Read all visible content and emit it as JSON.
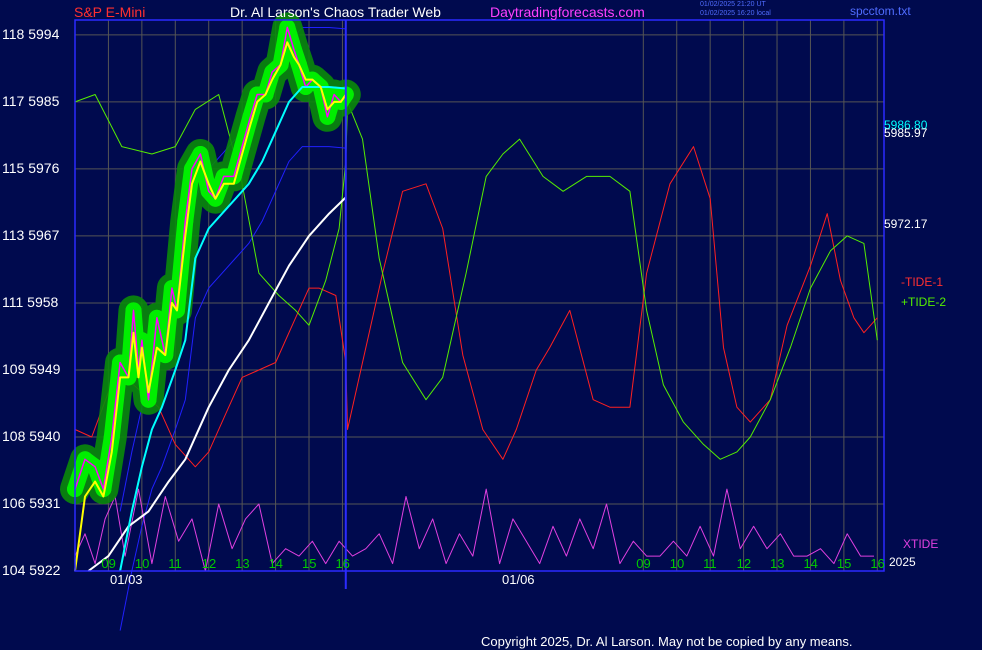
{
  "header": {
    "instrument": "S&P E-Mini",
    "site_title": "Dr. Al Larson's Chaos Trader Web",
    "site_link": "Daytradingforecasts.com",
    "timestamp_ut": "01/02/2025 21:20 UT",
    "timestamp_local": "01/02/2025 16:20 local",
    "data_file": "spcctom.txt"
  },
  "footer": {
    "copyright": "Copyright 2025, Dr. Al Larson. May not be copied by any means."
  },
  "colors": {
    "background": "#000a4e",
    "frame": "#2b2bff",
    "grid": "#555555",
    "price_halo": "#00ee00",
    "price_core": "#ff00ff",
    "fast_ma": "#ffff00",
    "medium_ma": "#00ffff",
    "slow_ma": "#ffffff",
    "tide_1": "#ff2020",
    "tide_2": "#55ee00",
    "xtide": "#e040e0",
    "channel": "#2020ff"
  },
  "chart_data": {
    "type": "line",
    "title": "S&P E-Mini",
    "y_axis_labels": [
      "118 5994",
      "117 5985",
      "115 5976",
      "113 5967",
      "111 5958",
      "109 5949",
      "108 5940",
      "106 5931",
      "104 5922"
    ],
    "y_ticks": [
      5994,
      5985,
      5976,
      5967,
      5958,
      5949,
      5940,
      5931,
      5922
    ],
    "ylim": [
      5922,
      5996
    ],
    "x_tick_labels": [
      "09",
      "10",
      "11",
      "12",
      "13",
      "14",
      "15",
      "16",
      "09",
      "10",
      "11",
      "12",
      "13",
      "14",
      "15",
      "16"
    ],
    "x_hours": [
      9,
      10,
      11,
      12,
      13,
      14,
      15,
      16,
      25,
      26,
      27,
      28,
      29,
      30,
      31,
      32
    ],
    "x_range_hours": [
      8,
      32.2
    ],
    "session_divider_hour": 16.1,
    "dates": [
      {
        "label": "01/03",
        "hour": 8.6
      },
      {
        "label": "01/06",
        "hour": 24.9
      }
    ],
    "year_label": "2025",
    "grid": true,
    "price_readouts": [
      "5986.80",
      "5985.97",
      "5972.17"
    ],
    "series": [
      {
        "name": "price",
        "x": [
          8.0,
          8.3,
          8.6,
          8.85,
          9.1,
          9.35,
          9.6,
          9.75,
          9.9,
          10.0,
          10.2,
          10.45,
          10.7,
          10.9,
          11.05,
          11.3,
          11.5,
          11.75,
          12.0,
          12.2,
          12.45,
          12.75,
          13.0,
          13.25,
          13.45,
          13.7,
          13.9,
          14.15,
          14.35,
          14.55,
          14.7,
          14.9,
          15.1,
          15.35,
          15.55,
          15.75,
          15.95,
          16.1
        ],
        "y": [
          5933,
          5937,
          5936,
          5933,
          5940,
          5950,
          5948,
          5957,
          5949,
          5953,
          5945,
          5956,
          5951,
          5960,
          5957,
          5969,
          5976,
          5978,
          5973,
          5972,
          5975,
          5975,
          5979,
          5983,
          5986,
          5986,
          5989,
          5990,
          5995,
          5992,
          5990,
          5987,
          5988,
          5987,
          5983,
          5986,
          5985,
          5986
        ]
      },
      {
        "name": "fast average",
        "x": [
          8.0,
          8.3,
          8.6,
          8.85,
          9.1,
          9.35,
          9.6,
          9.75,
          9.9,
          10.0,
          10.2,
          10.45,
          10.7,
          10.9,
          11.05,
          11.3,
          11.5,
          11.75,
          12.0,
          12.2,
          12.45,
          12.75,
          13.0,
          13.25,
          13.45,
          13.7,
          13.9,
          14.15,
          14.35,
          14.55,
          14.7,
          14.9,
          15.1,
          15.35,
          15.55,
          15.75,
          15.95,
          16.1
        ],
        "y": [
          5922,
          5932,
          5934,
          5932,
          5938,
          5948,
          5948,
          5954,
          5948,
          5952,
          5946,
          5952,
          5951,
          5958,
          5957,
          5967,
          5974,
          5977,
          5974,
          5972,
          5974,
          5974,
          5978,
          5982,
          5985,
          5986,
          5988,
          5990,
          5993,
          5991,
          5990,
          5988,
          5988,
          5987,
          5984,
          5985,
          5985,
          5985.97
        ]
      },
      {
        "name": "medium average",
        "x": [
          9.35,
          9.7,
          10.0,
          10.3,
          10.6,
          11.0,
          11.3,
          11.6,
          12.0,
          12.4,
          12.8,
          13.2,
          13.6,
          14.0,
          14.4,
          14.8,
          15.2,
          15.6,
          16.1
        ],
        "y": [
          5922,
          5930,
          5936,
          5941,
          5944,
          5949,
          5953,
          5964,
          5968,
          5970,
          5972,
          5974,
          5977,
          5981,
          5985,
          5987,
          5987,
          5987,
          5986.8
        ]
      },
      {
        "name": "slow average",
        "x": [
          8.4,
          9.0,
          9.6,
          10.2,
          10.8,
          11.3,
          12.0,
          12.6,
          13.2,
          13.8,
          14.4,
          15.0,
          15.6,
          16.1
        ],
        "y": [
          5922,
          5924,
          5928,
          5930,
          5934,
          5937,
          5944,
          5949,
          5953,
          5958,
          5963,
          5967,
          5970,
          5972.17
        ]
      },
      {
        "name": "TIDE-1",
        "x": [
          8.0,
          8.5,
          9.0,
          9.5,
          10.0,
          10.5,
          11.0,
          11.6,
          12.0,
          12.5,
          13.0,
          13.5,
          14.0,
          14.6,
          15.0,
          15.3,
          15.8,
          16.1,
          16.15,
          16.6,
          17.2,
          17.8,
          18.5,
          19.0,
          19.6,
          20.2,
          20.8,
          21.2,
          21.8,
          22.2,
          22.8,
          23.5,
          24.0,
          24.6,
          25.1,
          25.8,
          26.5,
          27.0,
          27.4,
          27.8,
          28.2,
          28.8,
          29.3,
          30.0,
          30.5,
          30.9,
          31.3,
          31.6,
          32.0
        ],
        "y": [
          5941,
          5940,
          5946,
          5948,
          5946,
          5944,
          5939,
          5936,
          5938,
          5943,
          5948,
          5949,
          5950,
          5956,
          5960,
          5960,
          5959,
          5950,
          5941,
          5950,
          5962,
          5973,
          5974,
          5968,
          5951,
          5941,
          5937,
          5941,
          5949,
          5952,
          5957,
          5945,
          5944,
          5944,
          5962,
          5974,
          5979,
          5972,
          5952,
          5944,
          5942,
          5945,
          5955,
          5963,
          5970,
          5961,
          5956,
          5954,
          5956
        ]
      },
      {
        "name": "TIDE-2",
        "x": [
          8.0,
          8.6,
          9.4,
          10.3,
          11.0,
          11.6,
          12.3,
          13.0,
          13.5,
          14.1,
          14.6,
          15.0,
          15.5,
          15.9,
          16.1,
          16.15,
          16.6,
          17.1,
          17.8,
          18.5,
          19.0,
          19.7,
          20.3,
          20.8,
          21.3,
          22.0,
          22.6,
          23.3,
          24.0,
          24.6,
          25.1,
          25.6,
          26.2,
          26.8,
          27.3,
          27.8,
          28.2,
          28.8,
          29.4,
          30.0,
          30.6,
          31.1,
          31.6,
          32.0
        ],
        "y": [
          5985,
          5986,
          5979,
          5978,
          5979,
          5984,
          5986,
          5974,
          5962,
          5959,
          5957,
          5955,
          5961,
          5968,
          5977,
          5985,
          5980,
          5964,
          5950,
          5945,
          5948,
          5962,
          5975,
          5978,
          5980,
          5975,
          5973,
          5975,
          5975,
          5973,
          5957,
          5947,
          5942,
          5939,
          5937,
          5938,
          5940,
          5945,
          5952,
          5960,
          5965,
          5967,
          5966,
          5953
        ]
      },
      {
        "name": "XTIDE",
        "x": [
          8.0,
          8.3,
          8.6,
          8.9,
          9.2,
          9.5,
          9.9,
          10.3,
          10.7,
          11.1,
          11.5,
          11.9,
          12.3,
          12.7,
          13.1,
          13.5,
          13.9,
          14.3,
          14.7,
          15.1,
          15.5,
          15.9,
          16.3,
          16.7,
          17.1,
          17.5,
          17.9,
          18.3,
          18.7,
          19.1,
          19.5,
          19.9,
          20.3,
          20.7,
          21.1,
          21.5,
          21.9,
          22.3,
          22.7,
          23.1,
          23.5,
          23.9,
          24.3,
          24.7,
          25.1,
          25.5,
          25.9,
          26.3,
          26.7,
          27.1,
          27.5,
          27.9,
          28.3,
          28.7,
          29.1,
          29.5,
          29.9,
          30.3,
          30.7,
          31.1,
          31.5,
          31.9
        ],
        "y": [
          5924,
          5927,
          5923,
          5929,
          5932,
          5924,
          5933,
          5923,
          5932,
          5926,
          5929,
          5922,
          5931,
          5925,
          5929,
          5931,
          5923,
          5925,
          5924,
          5926,
          5923,
          5926,
          5924,
          5925,
          5927,
          5923,
          5932,
          5925,
          5929,
          5923,
          5927,
          5924,
          5933,
          5923,
          5929,
          5926,
          5923,
          5928,
          5924,
          5929,
          5925,
          5931,
          5923,
          5926,
          5924,
          5924,
          5926,
          5924,
          5928,
          5924,
          5933,
          5925,
          5928,
          5925,
          5927,
          5924,
          5924,
          5925,
          5923,
          5927,
          5924,
          5924
        ]
      }
    ]
  },
  "legend": {
    "tide_1": "-TIDE-1",
    "tide_2": "+TIDE-2",
    "xtide": "XTIDE"
  }
}
